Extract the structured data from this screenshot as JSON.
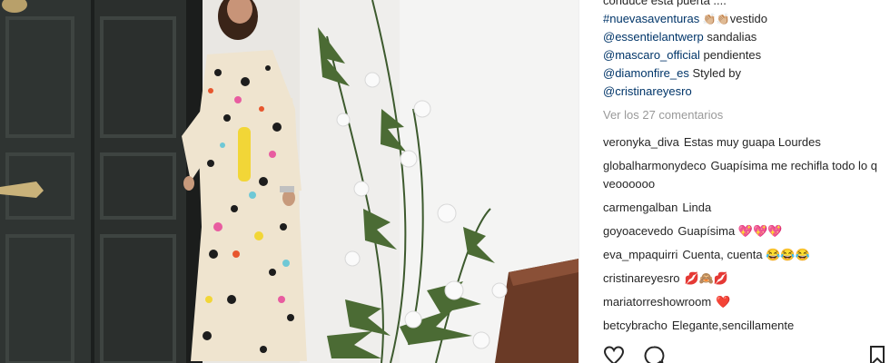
{
  "caption": {
    "line1": "conduce esta puerta ....",
    "line2_hashtag": "#nuevasaventuras",
    "line2_emoji": "👏🏼👏🏼",
    "line2_rest": "vestido",
    "line3_mention": "@essentielantwerp",
    "line3_rest": " sandalias",
    "line4_mention": "@mascaro_official",
    "line4_rest": " pendientes",
    "line5_mention": "@diamonfire_es",
    "line5_rest": " Styled by",
    "line6_mention": "@cristinareyesro"
  },
  "view_all": "Ver los 27 comentarios",
  "comments": [
    {
      "user": "veronyka_diva",
      "text": "Estas muy guapa Lourdes"
    },
    {
      "user": "globalharmonydeco",
      "text": "Guapísima me rechifla todo lo q veoooooo"
    },
    {
      "user": "carmengalban",
      "text": "Linda"
    },
    {
      "user": "goyoacevedo",
      "text": "Guapísima 💖💖💖"
    },
    {
      "user": "eva_mpaquirri",
      "text": "Cuenta, cuenta 😂😂😂"
    },
    {
      "user": "cristinareyesro",
      "text": "💋🙈💋"
    },
    {
      "user": "mariatorreshowroom",
      "text": "❤️"
    },
    {
      "user": "betcybracho",
      "text": "Elegante,sencillamente"
    }
  ],
  "icons": {
    "like": "heart-outline-icon",
    "comment": "comment-bubble-icon",
    "save": "bookmark-icon"
  },
  "colors": {
    "text": "#262626",
    "link": "#003569",
    "muted": "#999999",
    "door": "#2c302e"
  }
}
